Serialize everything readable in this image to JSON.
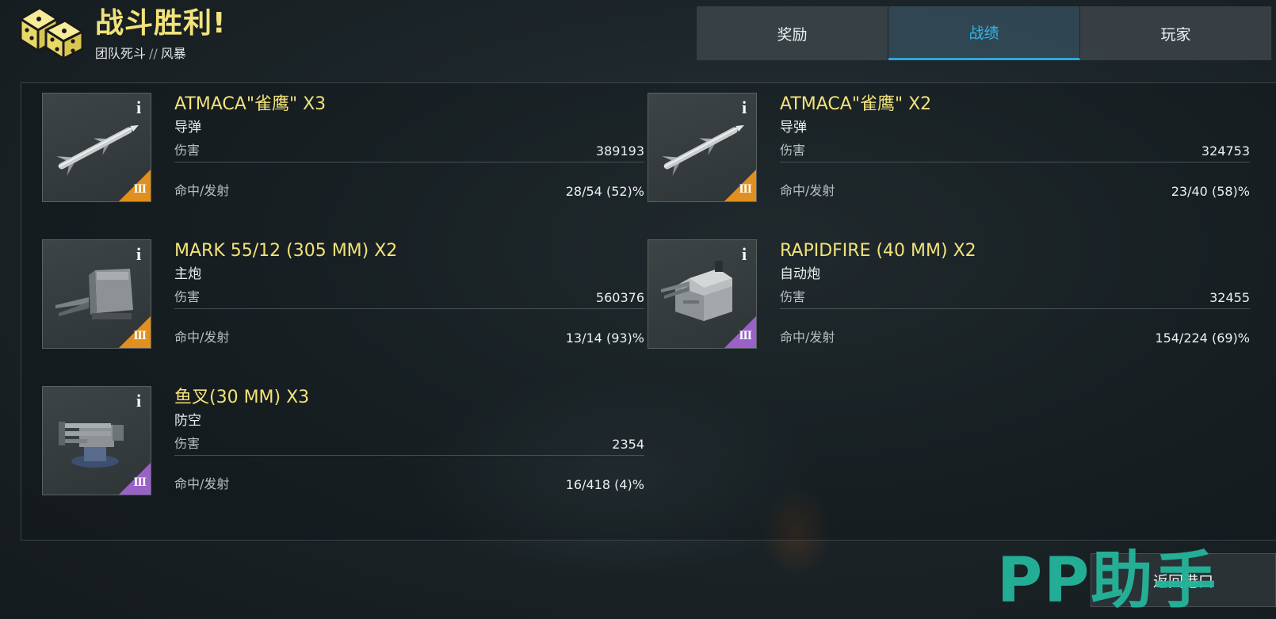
{
  "header": {
    "title": "战斗胜利!",
    "mode": "团队死斗",
    "separator": "//",
    "map": "风暴",
    "icon": "dice-icon"
  },
  "tabs": [
    {
      "label": "奖励",
      "active": false
    },
    {
      "label": "战绩",
      "active": true
    },
    {
      "label": "玩家",
      "active": false
    }
  ],
  "weapons": [
    {
      "name": "ATMACA\"雀鹰\" X3",
      "type": "导弹",
      "damage_label": "伤害",
      "damage": "389193",
      "hits_label": "命中/发射",
      "hits": "28/54 (52)%",
      "tier": "III",
      "tier_color": "#e0901f",
      "icon": "missile-icon"
    },
    {
      "name": "ATMACA\"雀鹰\" X2",
      "type": "导弹",
      "damage_label": "伤害",
      "damage": "324753",
      "hits_label": "命中/发射",
      "hits": "23/40 (58)%",
      "tier": "III",
      "tier_color": "#e0901f",
      "icon": "missile-icon"
    },
    {
      "name": "MARK 55/12 (305 MM) X2",
      "type": "主炮",
      "damage_label": "伤害",
      "damage": "560376",
      "hits_label": "命中/发射",
      "hits": "13/14 (93)%",
      "tier": "III",
      "tier_color": "#e0901f",
      "icon": "main-gun-turret-icon"
    },
    {
      "name": "RAPIDFIRE (40 MM) X2",
      "type": "自动炮",
      "damage_label": "伤害",
      "damage": "32455",
      "hits_label": "命中/发射",
      "hits": "154/224 (69)%",
      "tier": "III",
      "tier_color": "#9a62c9",
      "icon": "autocannon-turret-icon"
    },
    {
      "name": "鱼叉(30 MM) X3",
      "type": "防空",
      "damage_label": "伤害",
      "damage": "2354",
      "hits_label": "命中/发射",
      "hits": "16/418 (4)%",
      "tier": "III",
      "tier_color": "#9a62c9",
      "icon": "aa-gun-icon"
    }
  ],
  "footer": {
    "return_label": "返回港口",
    "watermark": "PP助手"
  }
}
